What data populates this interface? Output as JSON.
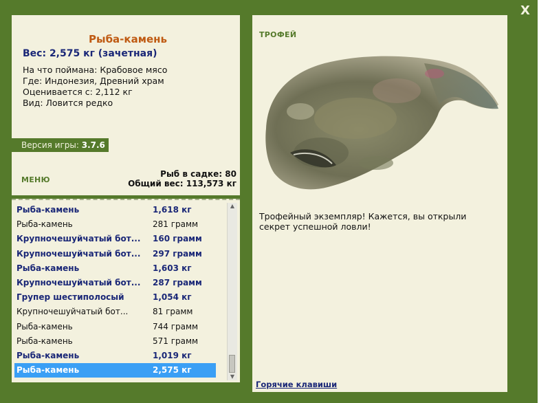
{
  "close_label": "X",
  "fish": {
    "title": "Рыба-камень",
    "weight_line": "Вес: 2,575 кг (зачетная)",
    "info": [
      "На что поймана: Крабовое мясо",
      "Где: Индонезия, Древний храм",
      "Оценивается с: 2,112 кг",
      "Вид: Ловится редко"
    ]
  },
  "version": {
    "label": "Версия игры:",
    "value": "3.7.6"
  },
  "menu_label": "МЕНЮ",
  "stats": {
    "count_line": "Рыб в садке: 80",
    "weight_line": "Общий вес: 113,573 кг"
  },
  "catch_list": [
    {
      "name": "Рыба-камень",
      "weight": "1,618 кг",
      "bold": true,
      "selected": false
    },
    {
      "name": "Рыба-камень",
      "weight": "281 грамм",
      "bold": false,
      "selected": false
    },
    {
      "name": "Крупночешуйчатый бот...",
      "weight": "160 грамм",
      "bold": true,
      "selected": false
    },
    {
      "name": "Крупночешуйчатый бот...",
      "weight": "297 грамм",
      "bold": true,
      "selected": false
    },
    {
      "name": "Рыба-камень",
      "weight": "1,603 кг",
      "bold": true,
      "selected": false
    },
    {
      "name": "Крупночешуйчатый бот...",
      "weight": "287 грамм",
      "bold": true,
      "selected": false
    },
    {
      "name": "Групер шестиполосый",
      "weight": "1,054 кг",
      "bold": true,
      "selected": false
    },
    {
      "name": "Крупночешуйчатый бот...",
      "weight": "81 грамм",
      "bold": false,
      "selected": false
    },
    {
      "name": "Рыба-камень",
      "weight": "744 грамм",
      "bold": false,
      "selected": false
    },
    {
      "name": "Рыба-камень",
      "weight": "571 грамм",
      "bold": false,
      "selected": false
    },
    {
      "name": "Рыба-камень",
      "weight": "1,019 кг",
      "bold": true,
      "selected": false
    },
    {
      "name": "Рыба-камень",
      "weight": "2,575 кг",
      "bold": true,
      "selected": true
    }
  ],
  "trophy": {
    "label": "ТРОФЕЙ",
    "text": "Трофейный экземпляр! Кажется, вы открыли секрет успешной ловли!"
  },
  "hotkeys_label": "Горячие клавиши",
  "colors": {
    "frame": "#557a2b",
    "panel": "#f3f1de",
    "selected_row": "#3a9ff5",
    "title": "#bf5a12",
    "navy": "#1a2777"
  }
}
